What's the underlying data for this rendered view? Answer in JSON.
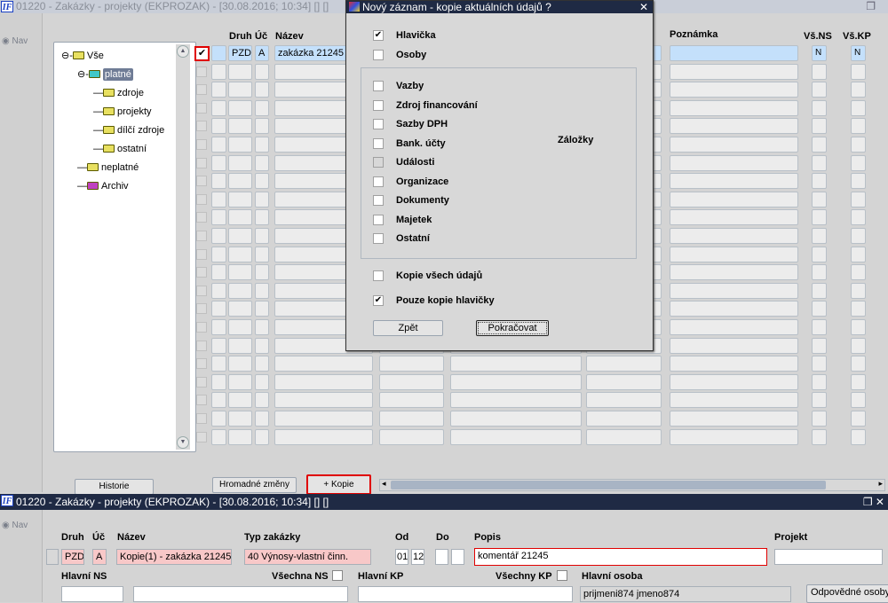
{
  "window": {
    "title": "01220 - Zakázky - projekty (EKPROZAK) - [30.08.2016; 10:34]  [] []",
    "logo": "IF",
    "nav": "Nav"
  },
  "tree": {
    "root": "Vše",
    "platne": "platné",
    "children": [
      "zdroje",
      "projekty",
      "dílčí zdroje",
      "ostatní"
    ],
    "neplatne": "neplatné",
    "archiv": "Archiv"
  },
  "grid": {
    "headers": {
      "druh": "Druh",
      "uc": "Úč",
      "nazev": "Název",
      "poznamka": "Poznámka",
      "vsns": "Vš.NS",
      "vskp": "Vš.KP"
    },
    "first_row": {
      "checked": true,
      "druh": "PZD",
      "uc": "A",
      "nazev": "zakázka 21245",
      "vsns": "N",
      "vskp": "N"
    },
    "row_count": 22
  },
  "buttons": {
    "historie": "Historie",
    "hromadne": "Hromadné změny",
    "kopie": "+ Kopie"
  },
  "dialog": {
    "title": "Nový záznam - kopie aktuálních údajů ?",
    "hlavicka": {
      "label": "Hlavička",
      "checked": true
    },
    "osoby": {
      "label": "Osoby",
      "checked": false
    },
    "zalozky_label": "Záložky",
    "tabs": [
      {
        "label": "Vazby",
        "checked": false
      },
      {
        "label": "Zdroj financování",
        "checked": false
      },
      {
        "label": "Sazby DPH",
        "checked": false
      },
      {
        "label": "Bank. účty",
        "checked": false
      },
      {
        "label": "Události",
        "checked": false,
        "disabled": true
      },
      {
        "label": "Organizace",
        "checked": false
      },
      {
        "label": "Dokumenty",
        "checked": false
      },
      {
        "label": "Majetek",
        "checked": false
      },
      {
        "label": "Ostatní",
        "checked": false
      }
    ],
    "kopie_vsech": {
      "label": "Kopie všech údajů",
      "checked": false
    },
    "pouze_hlavicky": {
      "label": "Pouze kopie hlavičky",
      "checked": true
    },
    "zpet": "Zpět",
    "pokracovat": "Pokračovat"
  },
  "form": {
    "title": "01220 - Zakázky - projekty (EKPROZAK) - [30.08.2016; 10:34]  [] []",
    "nav": "Nav",
    "labels": {
      "druh": "Druh",
      "uc": "Úč",
      "nazev": "Název",
      "typ": "Typ zakázky",
      "od": "Od",
      "do": "Do",
      "popis": "Popis",
      "projekt": "Projekt",
      "hlavni_ns": "Hlavní NS",
      "vsechna_ns": "Všechna NS",
      "hlavni_kp": "Hlavní KP",
      "vsechny_kp": "Všechny KP",
      "hlavni_osoba": "Hlavní osoba"
    },
    "values": {
      "druh": "PZD",
      "uc": "A",
      "nazev": "Kopie(1) - zakázka 21245",
      "typ": "40 Výnosy-vlastní činn.",
      "od1": "01",
      "od2": "12",
      "popis": "komentář 21245",
      "hlavni_osoba": "prijmeni874 jmeno874"
    },
    "odpovedne": "Odpovědné osoby"
  }
}
